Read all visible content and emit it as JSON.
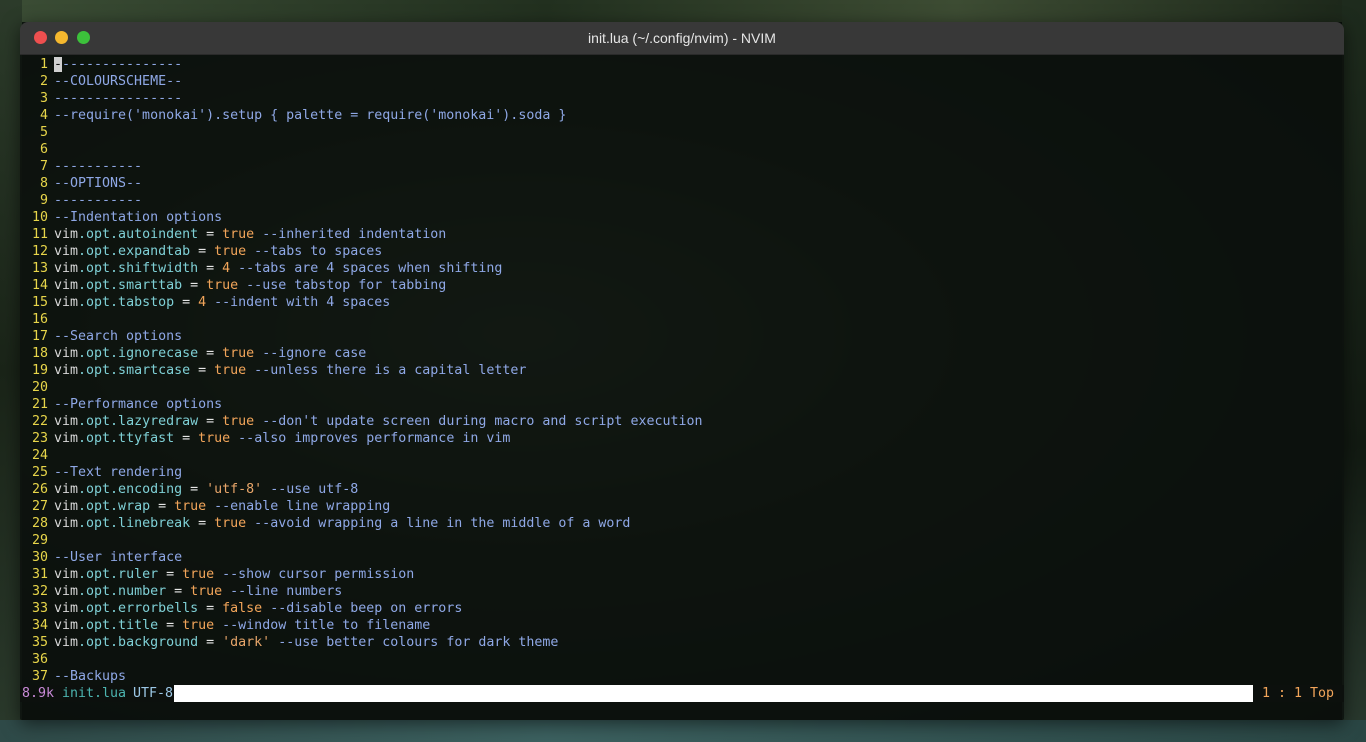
{
  "window": {
    "title": "init.lua (~/.config/nvim) - NVIM"
  },
  "editor": {
    "lines": [
      {
        "n": "1",
        "tokens": [
          {
            "t": "-",
            "c": "cursor"
          },
          {
            "t": "---------------",
            "c": "cmt"
          }
        ]
      },
      {
        "n": "2",
        "tokens": [
          {
            "t": "--COLOURSCHEME--",
            "c": "cmt"
          }
        ]
      },
      {
        "n": "3",
        "tokens": [
          {
            "t": "----------------",
            "c": "cmt"
          }
        ]
      },
      {
        "n": "4",
        "tokens": [
          {
            "t": "--require('monokai').setup { palette = require('monokai').soda }",
            "c": "cmt"
          }
        ]
      },
      {
        "n": "5",
        "tokens": []
      },
      {
        "n": "6",
        "tokens": []
      },
      {
        "n": "7",
        "tokens": [
          {
            "t": "-----------",
            "c": "cmt"
          }
        ]
      },
      {
        "n": "8",
        "tokens": [
          {
            "t": "--OPTIONS--",
            "c": "cmt"
          }
        ]
      },
      {
        "n": "9",
        "tokens": [
          {
            "t": "-----------",
            "c": "cmt"
          }
        ]
      },
      {
        "n": "10",
        "tokens": [
          {
            "t": "--Indentation options",
            "c": "cmt"
          }
        ]
      },
      {
        "n": "11",
        "tokens": [
          {
            "t": "vim",
            "c": "code"
          },
          {
            "t": ".opt.autoindent",
            "c": "prop"
          },
          {
            "t": " = ",
            "c": "op"
          },
          {
            "t": "true",
            "c": "bool"
          },
          {
            "t": " --inherited indentation",
            "c": "cmt"
          }
        ]
      },
      {
        "n": "12",
        "tokens": [
          {
            "t": "vim",
            "c": "code"
          },
          {
            "t": ".opt.expandtab",
            "c": "prop"
          },
          {
            "t": " = ",
            "c": "op"
          },
          {
            "t": "true",
            "c": "bool"
          },
          {
            "t": " --tabs to spaces",
            "c": "cmt"
          }
        ]
      },
      {
        "n": "13",
        "tokens": [
          {
            "t": "vim",
            "c": "code"
          },
          {
            "t": ".opt.shiftwidth",
            "c": "prop"
          },
          {
            "t": " = ",
            "c": "op"
          },
          {
            "t": "4",
            "c": "num"
          },
          {
            "t": " --tabs are 4 spaces when shifting",
            "c": "cmt"
          }
        ]
      },
      {
        "n": "14",
        "tokens": [
          {
            "t": "vim",
            "c": "code"
          },
          {
            "t": ".opt.smarttab",
            "c": "prop"
          },
          {
            "t": " = ",
            "c": "op"
          },
          {
            "t": "true",
            "c": "bool"
          },
          {
            "t": " --use tabstop for tabbing",
            "c": "cmt"
          }
        ]
      },
      {
        "n": "15",
        "tokens": [
          {
            "t": "vim",
            "c": "code"
          },
          {
            "t": ".opt.tabstop",
            "c": "prop"
          },
          {
            "t": " = ",
            "c": "op"
          },
          {
            "t": "4",
            "c": "num"
          },
          {
            "t": " --indent with 4 spaces",
            "c": "cmt"
          }
        ]
      },
      {
        "n": "16",
        "tokens": []
      },
      {
        "n": "17",
        "tokens": [
          {
            "t": "--Search options",
            "c": "cmt"
          }
        ]
      },
      {
        "n": "18",
        "tokens": [
          {
            "t": "vim",
            "c": "code"
          },
          {
            "t": ".opt.ignorecase",
            "c": "prop"
          },
          {
            "t": " = ",
            "c": "op"
          },
          {
            "t": "true",
            "c": "bool"
          },
          {
            "t": " --ignore case",
            "c": "cmt"
          }
        ]
      },
      {
        "n": "19",
        "tokens": [
          {
            "t": "vim",
            "c": "code"
          },
          {
            "t": ".opt.smartcase",
            "c": "prop"
          },
          {
            "t": " = ",
            "c": "op"
          },
          {
            "t": "true",
            "c": "bool"
          },
          {
            "t": " --unless there is a capital letter",
            "c": "cmt"
          }
        ]
      },
      {
        "n": "20",
        "tokens": []
      },
      {
        "n": "21",
        "tokens": [
          {
            "t": "--Performance options",
            "c": "cmt"
          }
        ]
      },
      {
        "n": "22",
        "tokens": [
          {
            "t": "vim",
            "c": "code"
          },
          {
            "t": ".opt.lazyredraw",
            "c": "prop"
          },
          {
            "t": " = ",
            "c": "op"
          },
          {
            "t": "true",
            "c": "bool"
          },
          {
            "t": " --don't update screen during macro and script execution",
            "c": "cmt"
          }
        ]
      },
      {
        "n": "23",
        "tokens": [
          {
            "t": "vim",
            "c": "code"
          },
          {
            "t": ".opt.ttyfast",
            "c": "prop"
          },
          {
            "t": " = ",
            "c": "op"
          },
          {
            "t": "true",
            "c": "bool"
          },
          {
            "t": " --also improves performance in vim",
            "c": "cmt"
          }
        ]
      },
      {
        "n": "24",
        "tokens": []
      },
      {
        "n": "25",
        "tokens": [
          {
            "t": "--Text rendering",
            "c": "cmt"
          }
        ]
      },
      {
        "n": "26",
        "tokens": [
          {
            "t": "vim",
            "c": "code"
          },
          {
            "t": ".opt.encoding",
            "c": "prop"
          },
          {
            "t": " = ",
            "c": "op"
          },
          {
            "t": "'utf-8'",
            "c": "str"
          },
          {
            "t": " --use utf-8",
            "c": "cmt"
          }
        ]
      },
      {
        "n": "27",
        "tokens": [
          {
            "t": "vim",
            "c": "code"
          },
          {
            "t": ".opt.wrap",
            "c": "prop"
          },
          {
            "t": " = ",
            "c": "op"
          },
          {
            "t": "true",
            "c": "bool"
          },
          {
            "t": " --enable line wrapping",
            "c": "cmt"
          }
        ]
      },
      {
        "n": "28",
        "tokens": [
          {
            "t": "vim",
            "c": "code"
          },
          {
            "t": ".opt.linebreak",
            "c": "prop"
          },
          {
            "t": " = ",
            "c": "op"
          },
          {
            "t": "true",
            "c": "bool"
          },
          {
            "t": " --avoid wrapping a line in the middle of a word",
            "c": "cmt"
          }
        ]
      },
      {
        "n": "29",
        "tokens": []
      },
      {
        "n": "30",
        "tokens": [
          {
            "t": "--User interface",
            "c": "cmt"
          }
        ]
      },
      {
        "n": "31",
        "tokens": [
          {
            "t": "vim",
            "c": "code"
          },
          {
            "t": ".opt.ruler",
            "c": "prop"
          },
          {
            "t": " = ",
            "c": "op"
          },
          {
            "t": "true",
            "c": "bool"
          },
          {
            "t": " --show cursor permission",
            "c": "cmt"
          }
        ]
      },
      {
        "n": "32",
        "tokens": [
          {
            "t": "vim",
            "c": "code"
          },
          {
            "t": ".opt.number",
            "c": "prop"
          },
          {
            "t": " = ",
            "c": "op"
          },
          {
            "t": "true",
            "c": "bool"
          },
          {
            "t": " --line numbers",
            "c": "cmt"
          }
        ]
      },
      {
        "n": "33",
        "tokens": [
          {
            "t": "vim",
            "c": "code"
          },
          {
            "t": ".opt.errorbells",
            "c": "prop"
          },
          {
            "t": " = ",
            "c": "op"
          },
          {
            "t": "false",
            "c": "bool"
          },
          {
            "t": " --disable beep on errors",
            "c": "cmt"
          }
        ]
      },
      {
        "n": "34",
        "tokens": [
          {
            "t": "vim",
            "c": "code"
          },
          {
            "t": ".opt.title",
            "c": "prop"
          },
          {
            "t": " = ",
            "c": "op"
          },
          {
            "t": "true",
            "c": "bool"
          },
          {
            "t": " --window title to filename",
            "c": "cmt"
          }
        ]
      },
      {
        "n": "35",
        "tokens": [
          {
            "t": "vim",
            "c": "code"
          },
          {
            "t": ".opt.background",
            "c": "prop"
          },
          {
            "t": " = ",
            "c": "op"
          },
          {
            "t": "'dark'",
            "c": "str"
          },
          {
            "t": " --use better colours for dark theme",
            "c": "cmt"
          }
        ]
      },
      {
        "n": "36",
        "tokens": []
      },
      {
        "n": "37",
        "tokens": [
          {
            "t": "--Backups",
            "c": "cmt"
          }
        ]
      }
    ]
  },
  "statusline": {
    "size": "8.9k",
    "filename": "init.lua",
    "encoding": "UTF-8",
    "position": "1 : 1 Top"
  }
}
